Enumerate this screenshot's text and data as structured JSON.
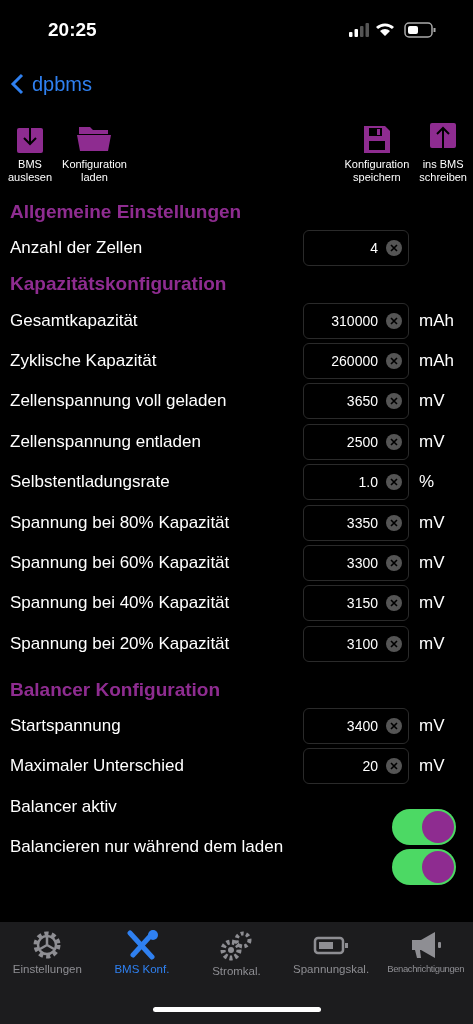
{
  "status_bar": {
    "time": "20:25"
  },
  "nav": {
    "back_label": "dpbms"
  },
  "toolbar": {
    "left": [
      {
        "kind": "download",
        "label": "BMS\nauslesen"
      },
      {
        "kind": "folder",
        "label": "Konfiguration\nladen"
      }
    ],
    "right": [
      {
        "kind": "save",
        "label": "Konfiguration\nspeichern"
      },
      {
        "kind": "upload",
        "label": "ins BMS\nschreiben"
      }
    ]
  },
  "sections": [
    {
      "title": "Allgemeine Einstellungen",
      "rows": [
        {
          "kind": "field",
          "label": "Anzahl der Zellen",
          "value": "4"
        }
      ]
    },
    {
      "title": "Kapazitätskonfiguration",
      "rows": [
        {
          "kind": "field",
          "label": "Gesamtkapazität",
          "value": "310000",
          "unit": "mAh"
        },
        {
          "kind": "field",
          "label": "Zyklische Kapazität",
          "value": "260000",
          "unit": "mAh"
        },
        {
          "kind": "field",
          "label": "Zellenspannung voll geladen",
          "value": "3650",
          "unit": "mV"
        },
        {
          "kind": "field",
          "label": "Zellenspannung entladen",
          "value": "2500",
          "unit": "mV"
        },
        {
          "kind": "field",
          "label": "Selbstentladungsrate",
          "value": "1.0",
          "unit": "%"
        },
        {
          "kind": "field",
          "label": "Spannung bei 80% Kapazität",
          "value": "3350",
          "unit": "mV"
        },
        {
          "kind": "field",
          "label": "Spannung bei 60% Kapazität",
          "value": "3300",
          "unit": "mV"
        },
        {
          "kind": "field",
          "label": "Spannung bei 40% Kapazität",
          "value": "3150",
          "unit": "mV"
        },
        {
          "kind": "field",
          "label": "Spannung bei 20% Kapazität",
          "value": "3100",
          "unit": "mV"
        }
      ]
    },
    {
      "title": "Balancer Konfiguration",
      "rows": [
        {
          "kind": "field",
          "label": "Startspannung",
          "value": "3400",
          "unit": "mV"
        },
        {
          "kind": "field",
          "label": "Maximaler Unterschied",
          "value": "20",
          "unit": "mV"
        },
        {
          "kind": "toggle",
          "label": "Balancer aktiv",
          "on": true
        },
        {
          "kind": "toggle",
          "label": "Balancieren nur während dem laden",
          "on": true
        }
      ]
    }
  ],
  "tab_bar": [
    {
      "kind": "gear",
      "label": "Einstellungen",
      "selected": false
    },
    {
      "kind": "tools",
      "label": "BMS Konf.",
      "selected": true
    },
    {
      "kind": "gears",
      "label": "Stromkal.",
      "selected": false
    },
    {
      "kind": "battery",
      "label": "Spannungskal.",
      "selected": false
    },
    {
      "kind": "megaphone",
      "label": "Benachrichtigungen",
      "selected": false
    }
  ]
}
